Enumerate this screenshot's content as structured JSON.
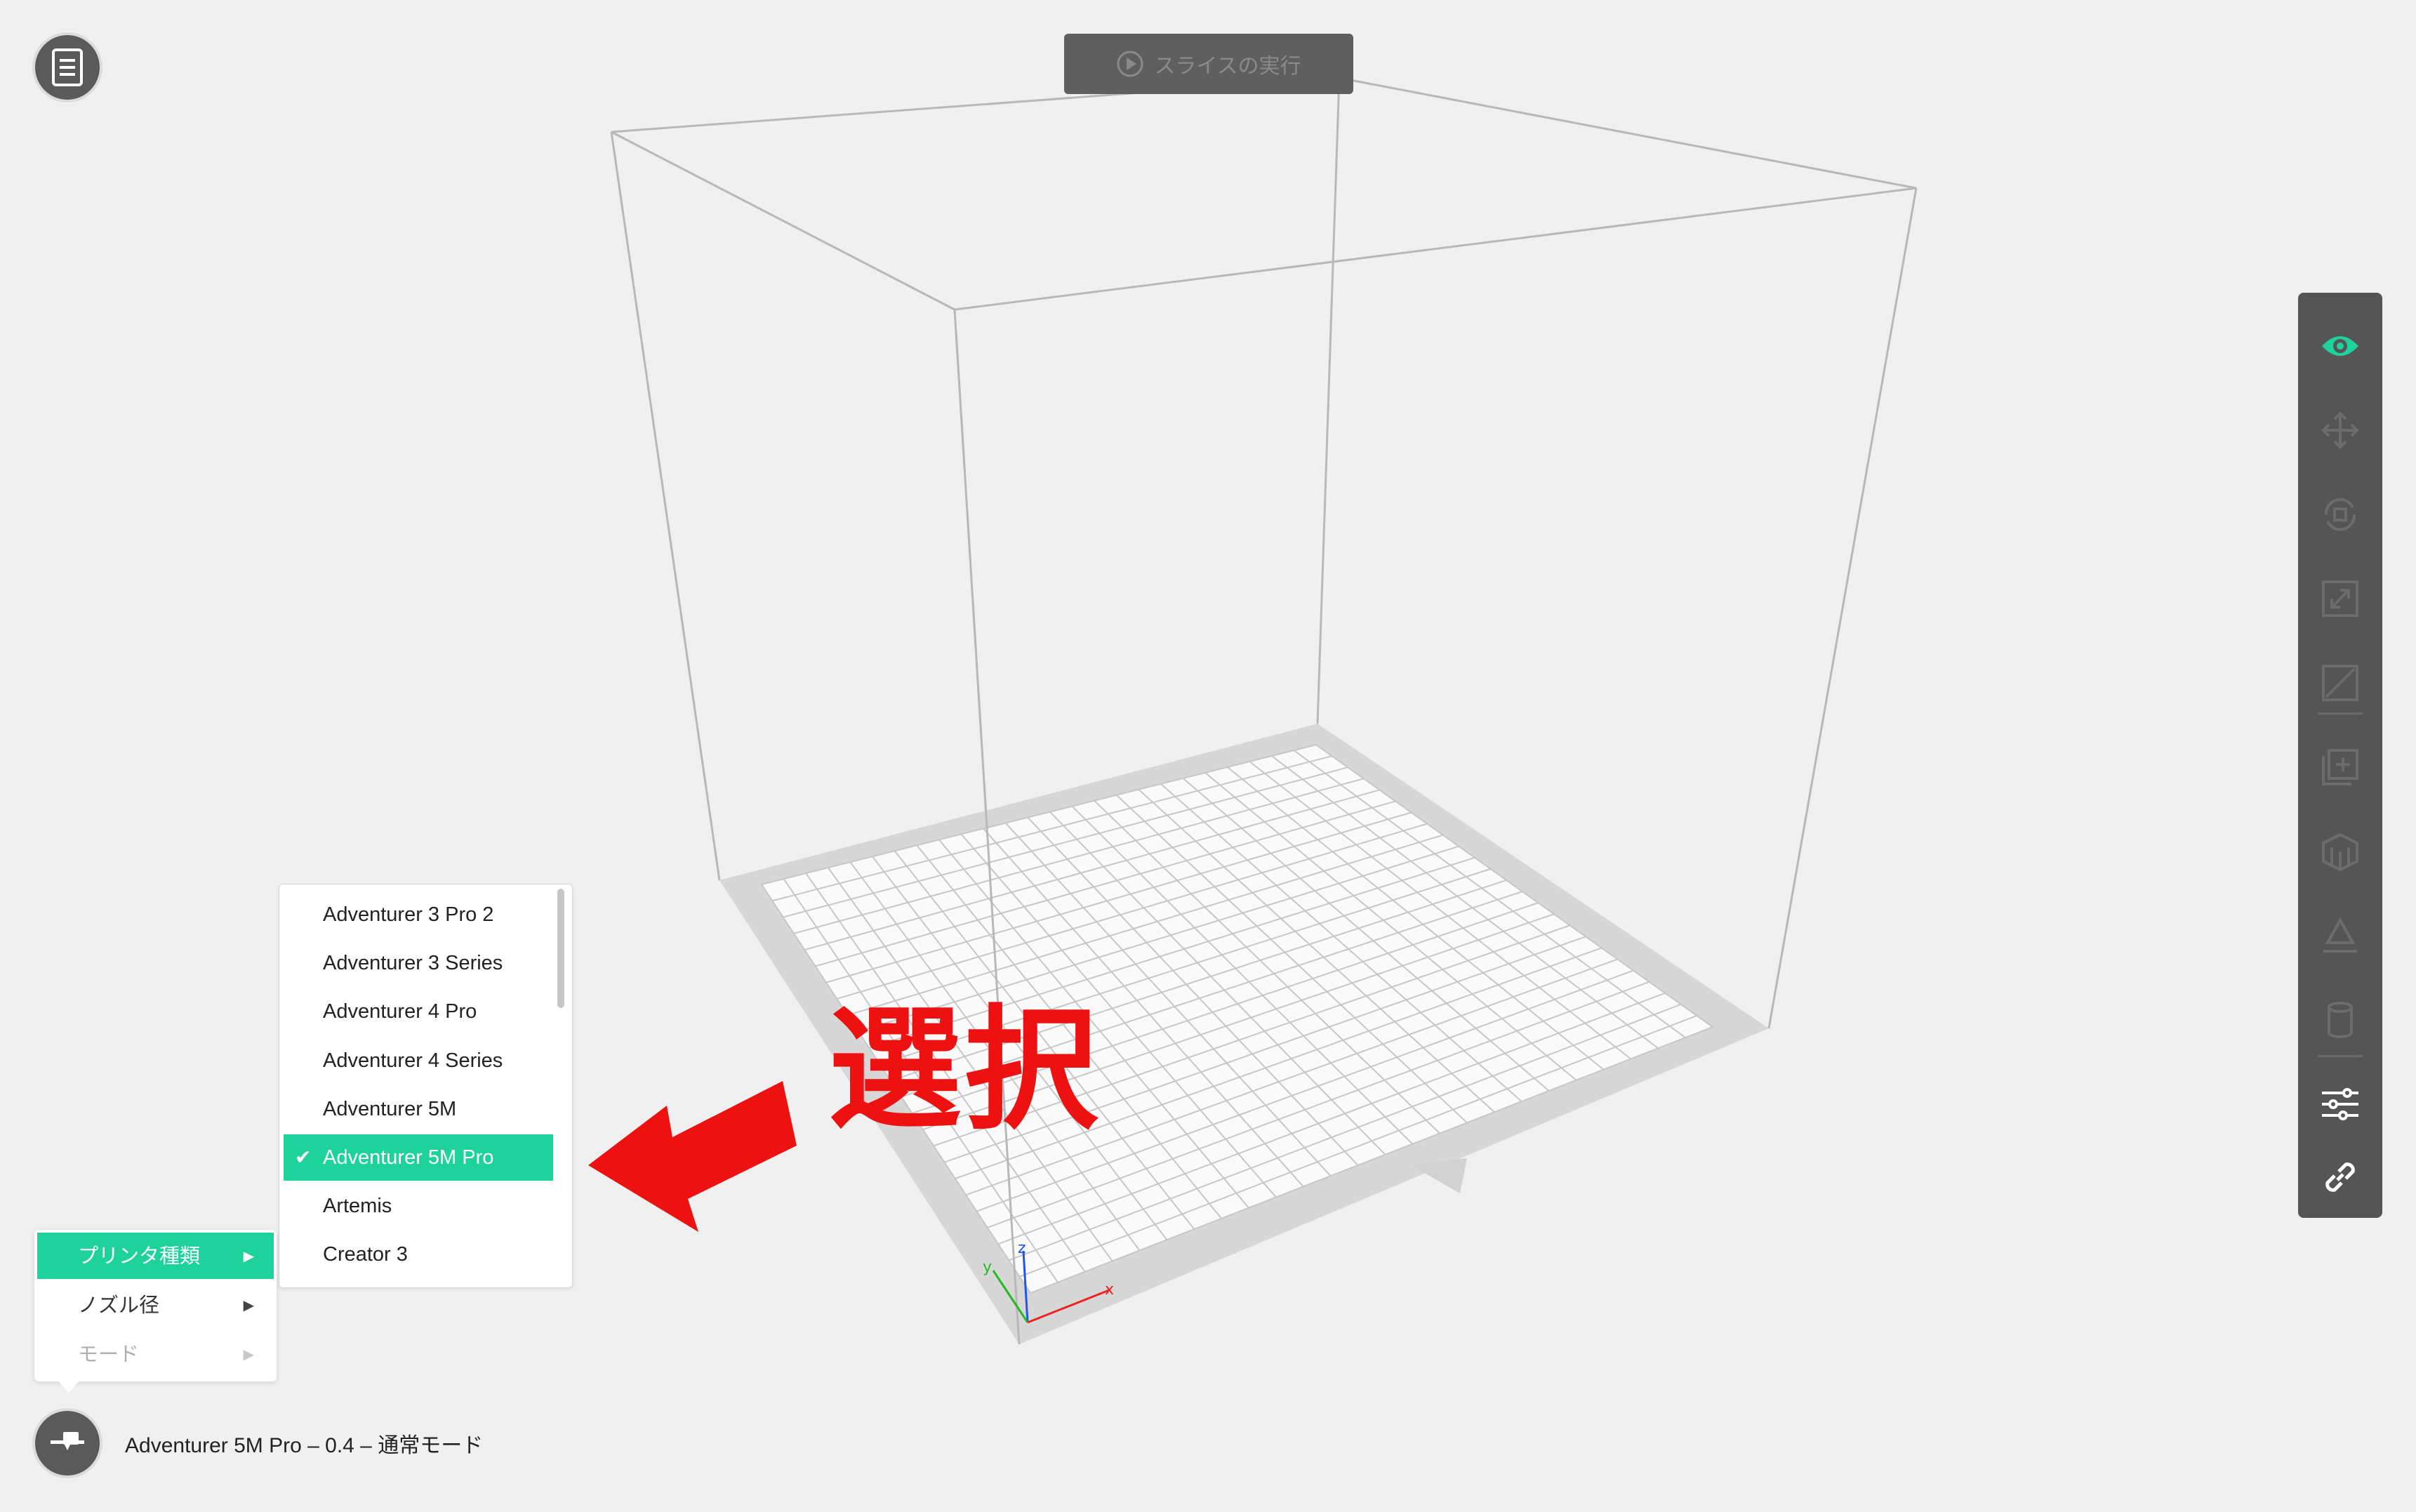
{
  "toolbar_top": {
    "slice_label": "スライスの実行"
  },
  "status": {
    "printer_summary": "Adventurer 5M Pro – 0.4 – 通常モード"
  },
  "context_menu": {
    "items": [
      {
        "label": "プリンタ種類",
        "state": "active"
      },
      {
        "label": "ノズル径",
        "state": "enabled"
      },
      {
        "label": "モード",
        "state": "disabled"
      }
    ]
  },
  "printer_menu": {
    "selected": "Adventurer 5M Pro",
    "items": [
      "Adventurer 3 Pro 2",
      "Adventurer 3 Series",
      "Adventurer 4 Pro",
      "Adventurer 4 Series",
      "Adventurer 5M",
      "Adventurer 5M Pro",
      "Artemis",
      "Creator 3"
    ]
  },
  "annotation": {
    "text": "選択",
    "color": "#ee1111"
  },
  "axes": {
    "x": "x",
    "y": "y",
    "z": "z"
  },
  "colors": {
    "accent": "#1ed39b",
    "toolbar": "#555555",
    "background": "#f0f0f0"
  },
  "right_toolbar": {
    "icons": [
      "eye-icon",
      "move-icon",
      "rotate-icon",
      "scale-icon",
      "mirror-icon",
      "add-object-icon",
      "support-icon",
      "lay-flat-icon",
      "cylinder-icon",
      "settings-sliders-icon",
      "link-icon"
    ]
  }
}
